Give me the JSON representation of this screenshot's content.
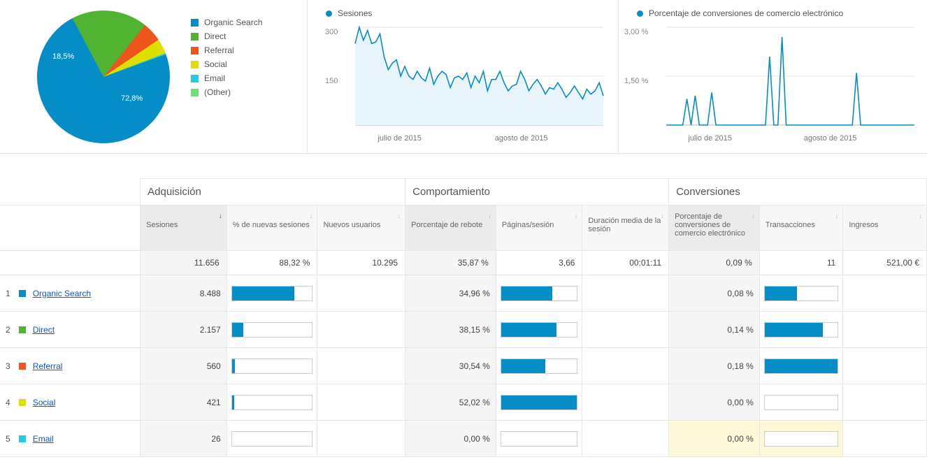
{
  "colors": {
    "blue": "#058dc7",
    "green": "#50b432",
    "orange": "#ed561b",
    "yellow": "#dddf00",
    "cyan": "#24cbe5",
    "teal": "#64e572"
  },
  "pie": {
    "label_big": "72,8%",
    "label_small": "18,5%"
  },
  "legend": [
    {
      "label": "Organic Search",
      "color": "#058dc7"
    },
    {
      "label": "Direct",
      "color": "#50b432"
    },
    {
      "label": "Referral",
      "color": "#ed561b"
    },
    {
      "label": "Social",
      "color": "#dddf00"
    },
    {
      "label": "Email",
      "color": "#24cbe5"
    },
    {
      "label": "(Other)",
      "color": "#64e572"
    }
  ],
  "chart1": {
    "title": "Sesiones",
    "y_top": "300",
    "y_mid": "150",
    "ticks": [
      "julio de 2015",
      "agosto de 2015"
    ]
  },
  "chart2": {
    "title": "Porcentaje de conversiones de comercio electrónico",
    "y_top": "3,00 %",
    "y_mid": "1,50 %",
    "ticks": [
      "julio de 2015",
      "agosto de 2015"
    ]
  },
  "groups": {
    "acq": "Adquisición",
    "beh": "Comportamiento",
    "conv": "Conversiones"
  },
  "headers": {
    "sessions": "Sesiones",
    "pct_new": "% de nuevas sesiones",
    "new_users": "Nuevos usuarios",
    "bounce": "Porcentaje de rebote",
    "pages": "Páginas/sesión",
    "duration": "Duración media de la sesión",
    "conv_pct": "Porcentaje de conversiones de comercio electrónico",
    "trans": "Transacciones",
    "rev": "Ingresos"
  },
  "totals": {
    "sessions": "11.656",
    "pct_new": "88,32 %",
    "new_users": "10.295",
    "bounce": "35,87 %",
    "pages": "3,66",
    "duration": "00:01:11",
    "conv_pct": "0,09 %",
    "trans": "11",
    "rev": "521,00 €"
  },
  "rows": [
    {
      "idx": "1",
      "name": "Organic Search",
      "color": "#058dc7",
      "sessions": "8.488",
      "bounce": "34,96 %",
      "conv": "0,08 %",
      "bar_new": 78,
      "bar_bounce": 67,
      "bar_conv": 44,
      "highlight": false
    },
    {
      "idx": "2",
      "name": "Direct",
      "color": "#50b432",
      "sessions": "2.157",
      "bounce": "38,15 %",
      "conv": "0,14 %",
      "bar_new": 14,
      "bar_bounce": 73,
      "bar_conv": 80,
      "highlight": false
    },
    {
      "idx": "3",
      "name": "Referral",
      "color": "#ed561b",
      "sessions": "560",
      "bounce": "30,54 %",
      "conv": "0,18 %",
      "bar_new": 4,
      "bar_bounce": 58,
      "bar_conv": 100,
      "highlight": false
    },
    {
      "idx": "4",
      "name": "Social",
      "color": "#dddf00",
      "sessions": "421",
      "bounce": "52,02 %",
      "conv": "0,00 %",
      "bar_new": 3,
      "bar_bounce": 100,
      "bar_conv": 0,
      "highlight": false
    },
    {
      "idx": "5",
      "name": "Email",
      "color": "#24cbe5",
      "sessions": "26",
      "bounce": "0,00 %",
      "conv": "0,00 %",
      "bar_new": 0,
      "bar_bounce": 0,
      "bar_conv": 0,
      "highlight": true
    }
  ],
  "chart_data": [
    {
      "type": "pie",
      "title": "Sesiones por canal",
      "series": [
        {
          "name": "Organic Search",
          "value": 72.8
        },
        {
          "name": "Direct",
          "value": 18.5
        },
        {
          "name": "Referral",
          "value": 4.8
        },
        {
          "name": "Social",
          "value": 3.6
        },
        {
          "name": "Email",
          "value": 0.2
        },
        {
          "name": "(Other)",
          "value": 0.1
        }
      ]
    },
    {
      "type": "line",
      "title": "Sesiones",
      "ylabel": "Sesiones",
      "ylim": [
        0,
        300
      ],
      "xlabel": "",
      "x_ticks": [
        "julio de 2015",
        "agosto de 2015"
      ],
      "x": [
        0,
        1,
        2,
        3,
        4,
        5,
        6,
        7,
        8,
        9,
        10,
        11,
        12,
        13,
        14,
        15,
        16,
        17,
        18,
        19,
        20,
        21,
        22,
        23,
        24,
        25,
        26,
        27,
        28,
        29,
        30,
        31,
        32,
        33,
        34,
        35,
        36,
        37,
        38,
        39,
        40,
        41,
        42,
        43,
        44,
        45,
        46,
        47,
        48,
        49,
        50,
        51,
        52,
        53,
        54,
        55,
        56,
        57,
        58,
        59,
        60
      ],
      "values": [
        250,
        300,
        260,
        290,
        250,
        255,
        280,
        210,
        170,
        190,
        200,
        150,
        180,
        150,
        140,
        165,
        145,
        135,
        175,
        125,
        150,
        165,
        155,
        115,
        145,
        150,
        140,
        160,
        115,
        150,
        130,
        165,
        105,
        140,
        140,
        165,
        130,
        105,
        120,
        125,
        165,
        140,
        105,
        125,
        140,
        120,
        95,
        115,
        110,
        130,
        110,
        85,
        100,
        120,
        100,
        80,
        110,
        95,
        105,
        130,
        90
      ]
    },
    {
      "type": "line",
      "title": "Porcentaje de conversiones de comercio electrónico",
      "ylabel": "%",
      "ylim": [
        0,
        3.0
      ],
      "xlabel": "",
      "x_ticks": [
        "julio de 2015",
        "agosto de 2015"
      ],
      "x": [
        0,
        1,
        2,
        3,
        4,
        5,
        6,
        7,
        8,
        9,
        10,
        11,
        12,
        13,
        14,
        15,
        16,
        17,
        18,
        19,
        20,
        21,
        22,
        23,
        24,
        25,
        26,
        27,
        28,
        29,
        30,
        31,
        32,
        33,
        34,
        35,
        36,
        37,
        38,
        39,
        40,
        41,
        42,
        43,
        44,
        45,
        46,
        47,
        48,
        49,
        50,
        51,
        52,
        53,
        54,
        55,
        56,
        57,
        58,
        59,
        60
      ],
      "values": [
        0,
        0,
        0,
        0,
        0,
        0.8,
        0,
        0.9,
        0,
        0,
        0,
        1.0,
        0,
        0,
        0,
        0,
        0,
        0,
        0,
        0,
        0,
        0,
        0,
        0,
        0,
        2.1,
        0,
        0,
        2.7,
        0,
        0,
        0,
        0,
        0,
        0,
        0,
        0,
        0,
        0,
        0,
        0,
        0,
        0,
        0,
        0,
        0,
        1.6,
        0,
        0,
        0,
        0,
        0,
        0,
        0,
        0,
        0,
        0,
        0,
        0,
        0,
        0
      ]
    }
  ]
}
